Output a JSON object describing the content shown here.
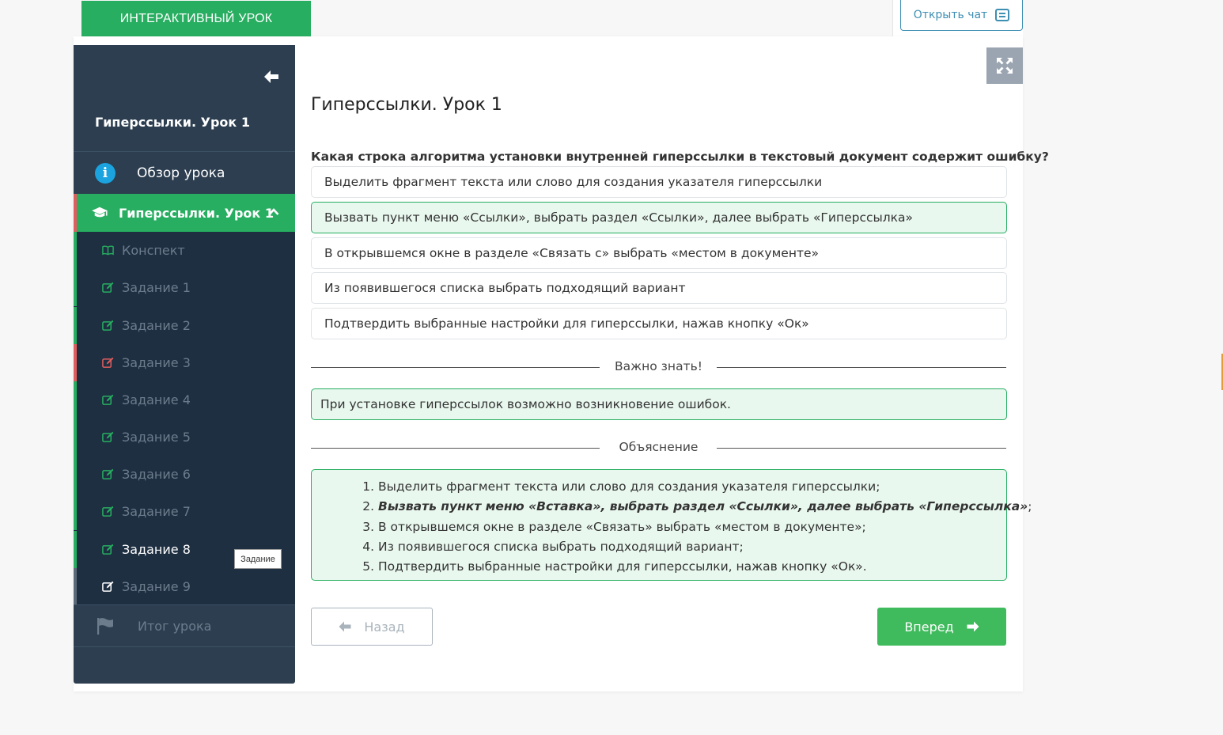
{
  "header": {
    "tab_label": "ИНТЕРАКТИВНЫЙ УРОК",
    "chat_button": "Открыть чат"
  },
  "sidebar": {
    "lesson_title": "Гиперссылки. Урок 1",
    "overview": "Обзор урока",
    "active_section": "Гиперссылки. Урок 1",
    "items": [
      {
        "label": "Конспект",
        "status": "done",
        "icon": "book-icon"
      },
      {
        "label": "Задание 1",
        "status": "done",
        "icon": "edit-icon"
      },
      {
        "label": "Задание 2",
        "status": "done",
        "icon": "edit-icon"
      },
      {
        "label": "Задание 3",
        "status": "wrong",
        "icon": "edit-icon"
      },
      {
        "label": "Задание 4",
        "status": "done",
        "icon": "edit-icon"
      },
      {
        "label": "Задание 5",
        "status": "done",
        "icon": "edit-icon"
      },
      {
        "label": "Задание 6",
        "status": "done",
        "icon": "edit-icon"
      },
      {
        "label": "Задание 7",
        "status": "done",
        "icon": "edit-icon"
      },
      {
        "label": "Задание 8",
        "status": "current",
        "icon": "edit-icon"
      },
      {
        "label": "Задание 9",
        "status": "pending",
        "icon": "edit-icon"
      }
    ],
    "tooltip": "Задание",
    "result": "Итог урока"
  },
  "main": {
    "title": "Гиперссылки. Урок 1",
    "question": "Какая строка алгоритма установки внутренней гиперссылки в текстовый документ содержит ошибку?",
    "options": [
      {
        "text": "Выделить фрагмент текста или слово для создания указателя гиперссылки",
        "selected": false
      },
      {
        "text": "Вызвать пункт меню «Ссылки», выбрать раздел «Ссылки», далее выбрать «Гиперссылка»",
        "selected": true
      },
      {
        "text": "В открывшемся окне в разделе «Связать с» выбрать «местом в документе»",
        "selected": false
      },
      {
        "text": "Из появившегося списка выбрать подходящий вариант",
        "selected": false
      },
      {
        "text": "Подтвердить выбранные настройки для гиперссылки, нажав кнопку «Ок»",
        "selected": false
      }
    ],
    "important_heading": "Важно знать!",
    "important_text": "При установке гиперссылок возможно возникновение ошибок.",
    "explanation_heading": "Объяснение",
    "explanation": [
      {
        "text": "Выделить фрагмент текста или слово для создания указателя гиперссылки;",
        "bold": "",
        "suffix": ""
      },
      {
        "text": "",
        "bold": "Вызвать пункт меню «Вставка», выбрать раздел «Ссылки», далее выбрать «Гиперссылка»",
        "suffix": ";"
      },
      {
        "text": "В открывшемся окне в разделе «Связать» выбрать «местом в документе»;",
        "bold": "",
        "suffix": ""
      },
      {
        "text": "Из появившегося списка выбрать подходящий вариант;",
        "bold": "",
        "suffix": ""
      },
      {
        "text": "Подтвердить выбранные настройки для гиперссылки, нажав кнопку «Ок».",
        "bold": "",
        "suffix": ""
      }
    ],
    "back_button": "Назад",
    "next_button": "Вперед"
  },
  "colors": {
    "accent_green": "#27ae60",
    "wrong_red": "#e05d5d",
    "sidebar_bg": "#2c3e50",
    "info_blue": "#1ba3e0"
  }
}
